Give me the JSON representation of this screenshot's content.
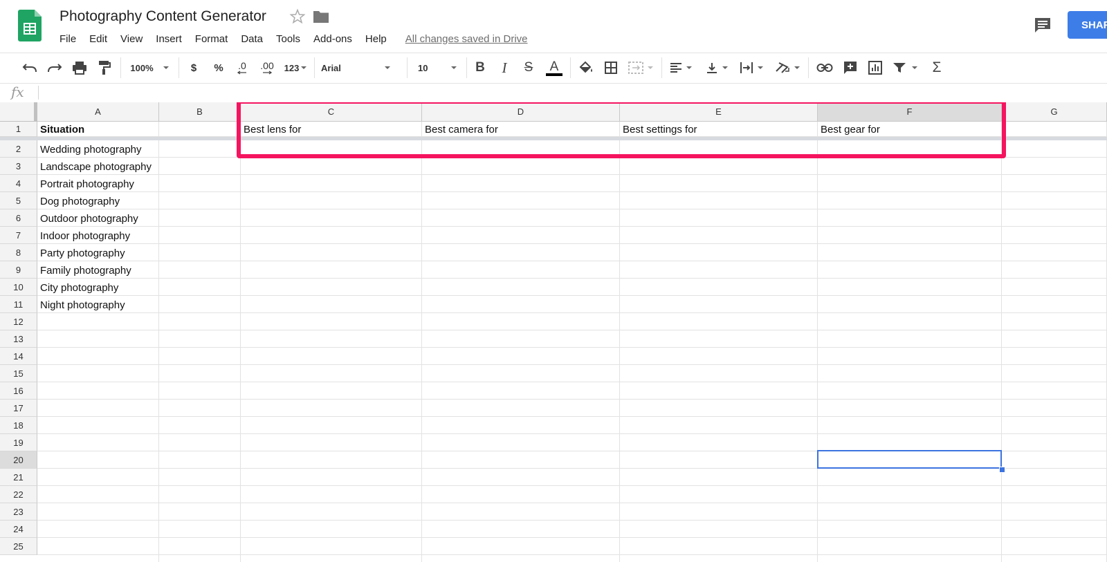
{
  "document": {
    "title": "Photography Content Generator",
    "save_status": "All changes saved in Drive"
  },
  "menu": [
    "File",
    "Edit",
    "View",
    "Insert",
    "Format",
    "Data",
    "Tools",
    "Add-ons",
    "Help"
  ],
  "share_label": "SHARE",
  "toolbar": {
    "zoom": "100%",
    "currency_label": "$",
    "percent_label": "%",
    "decrease_decimal_label": ".0",
    "increase_decimal_label": ".00",
    "more_formats_label": "123",
    "font": "Arial",
    "font_size": "10",
    "bold_label": "B",
    "italic_label": "I",
    "strike_label": "S",
    "text_color_label": "A",
    "functions_label": "Σ"
  },
  "formula_bar": {
    "fx_label": "fx",
    "value": ""
  },
  "columns": [
    "A",
    "B",
    "C",
    "D",
    "E",
    "F",
    "G"
  ],
  "rows": [
    "1",
    "2",
    "3",
    "4",
    "5",
    "6",
    "7",
    "8",
    "9",
    "10",
    "11",
    "12",
    "13",
    "14",
    "15",
    "16",
    "17",
    "18",
    "19",
    "20",
    "21",
    "22",
    "23",
    "24",
    "25"
  ],
  "selected_cell": {
    "column": "F",
    "row": "20"
  },
  "cells": {
    "A1": "Situation",
    "C1": "Best lens for",
    "D1": "Best camera for",
    "E1": "Best settings for",
    "F1": "Best gear for",
    "A2": "Wedding photography",
    "A3": "Landscape photography",
    "A4": "Portrait photography",
    "A5": "Dog photography",
    "A6": "Outdoor photography",
    "A7": "Indoor photography",
    "A8": "Party photography",
    "A9": "Family photography",
    "A10": "City photography",
    "A11": "Night photography"
  },
  "colors": {
    "highlight": "#f5145f",
    "selection": "#3b73e0",
    "share_button": "#3d7de8",
    "sheets_logo": "#1fa463"
  }
}
